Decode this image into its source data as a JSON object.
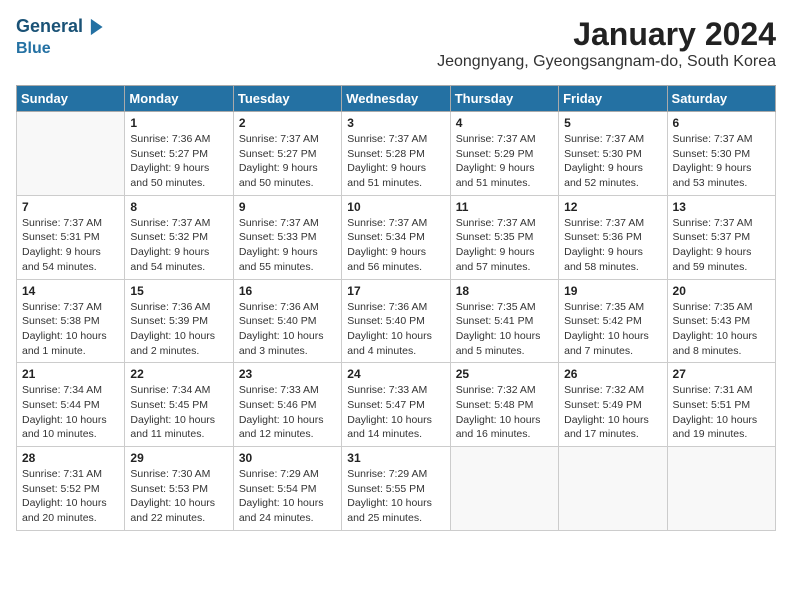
{
  "logo": {
    "line1": "General",
    "line2": "Blue",
    "arrow": "▶"
  },
  "title": "January 2024",
  "location": "Jeongnyang, Gyeongsangnam-do, South Korea",
  "weekdays": [
    "Sunday",
    "Monday",
    "Tuesday",
    "Wednesday",
    "Thursday",
    "Friday",
    "Saturday"
  ],
  "weeks": [
    [
      {
        "day": "",
        "info": ""
      },
      {
        "day": "1",
        "info": "Sunrise: 7:36 AM\nSunset: 5:27 PM\nDaylight: 9 hours\nand 50 minutes."
      },
      {
        "day": "2",
        "info": "Sunrise: 7:37 AM\nSunset: 5:27 PM\nDaylight: 9 hours\nand 50 minutes."
      },
      {
        "day": "3",
        "info": "Sunrise: 7:37 AM\nSunset: 5:28 PM\nDaylight: 9 hours\nand 51 minutes."
      },
      {
        "day": "4",
        "info": "Sunrise: 7:37 AM\nSunset: 5:29 PM\nDaylight: 9 hours\nand 51 minutes."
      },
      {
        "day": "5",
        "info": "Sunrise: 7:37 AM\nSunset: 5:30 PM\nDaylight: 9 hours\nand 52 minutes."
      },
      {
        "day": "6",
        "info": "Sunrise: 7:37 AM\nSunset: 5:30 PM\nDaylight: 9 hours\nand 53 minutes."
      }
    ],
    [
      {
        "day": "7",
        "info": "Sunrise: 7:37 AM\nSunset: 5:31 PM\nDaylight: 9 hours\nand 54 minutes."
      },
      {
        "day": "8",
        "info": "Sunrise: 7:37 AM\nSunset: 5:32 PM\nDaylight: 9 hours\nand 54 minutes."
      },
      {
        "day": "9",
        "info": "Sunrise: 7:37 AM\nSunset: 5:33 PM\nDaylight: 9 hours\nand 55 minutes."
      },
      {
        "day": "10",
        "info": "Sunrise: 7:37 AM\nSunset: 5:34 PM\nDaylight: 9 hours\nand 56 minutes."
      },
      {
        "day": "11",
        "info": "Sunrise: 7:37 AM\nSunset: 5:35 PM\nDaylight: 9 hours\nand 57 minutes."
      },
      {
        "day": "12",
        "info": "Sunrise: 7:37 AM\nSunset: 5:36 PM\nDaylight: 9 hours\nand 58 minutes."
      },
      {
        "day": "13",
        "info": "Sunrise: 7:37 AM\nSunset: 5:37 PM\nDaylight: 9 hours\nand 59 minutes."
      }
    ],
    [
      {
        "day": "14",
        "info": "Sunrise: 7:37 AM\nSunset: 5:38 PM\nDaylight: 10 hours\nand 1 minute."
      },
      {
        "day": "15",
        "info": "Sunrise: 7:36 AM\nSunset: 5:39 PM\nDaylight: 10 hours\nand 2 minutes."
      },
      {
        "day": "16",
        "info": "Sunrise: 7:36 AM\nSunset: 5:40 PM\nDaylight: 10 hours\nand 3 minutes."
      },
      {
        "day": "17",
        "info": "Sunrise: 7:36 AM\nSunset: 5:40 PM\nDaylight: 10 hours\nand 4 minutes."
      },
      {
        "day": "18",
        "info": "Sunrise: 7:35 AM\nSunset: 5:41 PM\nDaylight: 10 hours\nand 5 minutes."
      },
      {
        "day": "19",
        "info": "Sunrise: 7:35 AM\nSunset: 5:42 PM\nDaylight: 10 hours\nand 7 minutes."
      },
      {
        "day": "20",
        "info": "Sunrise: 7:35 AM\nSunset: 5:43 PM\nDaylight: 10 hours\nand 8 minutes."
      }
    ],
    [
      {
        "day": "21",
        "info": "Sunrise: 7:34 AM\nSunset: 5:44 PM\nDaylight: 10 hours\nand 10 minutes."
      },
      {
        "day": "22",
        "info": "Sunrise: 7:34 AM\nSunset: 5:45 PM\nDaylight: 10 hours\nand 11 minutes."
      },
      {
        "day": "23",
        "info": "Sunrise: 7:33 AM\nSunset: 5:46 PM\nDaylight: 10 hours\nand 12 minutes."
      },
      {
        "day": "24",
        "info": "Sunrise: 7:33 AM\nSunset: 5:47 PM\nDaylight: 10 hours\nand 14 minutes."
      },
      {
        "day": "25",
        "info": "Sunrise: 7:32 AM\nSunset: 5:48 PM\nDaylight: 10 hours\nand 16 minutes."
      },
      {
        "day": "26",
        "info": "Sunrise: 7:32 AM\nSunset: 5:49 PM\nDaylight: 10 hours\nand 17 minutes."
      },
      {
        "day": "27",
        "info": "Sunrise: 7:31 AM\nSunset: 5:51 PM\nDaylight: 10 hours\nand 19 minutes."
      }
    ],
    [
      {
        "day": "28",
        "info": "Sunrise: 7:31 AM\nSunset: 5:52 PM\nDaylight: 10 hours\nand 20 minutes."
      },
      {
        "day": "29",
        "info": "Sunrise: 7:30 AM\nSunset: 5:53 PM\nDaylight: 10 hours\nand 22 minutes."
      },
      {
        "day": "30",
        "info": "Sunrise: 7:29 AM\nSunset: 5:54 PM\nDaylight: 10 hours\nand 24 minutes."
      },
      {
        "day": "31",
        "info": "Sunrise: 7:29 AM\nSunset: 5:55 PM\nDaylight: 10 hours\nand 25 minutes."
      },
      {
        "day": "",
        "info": ""
      },
      {
        "day": "",
        "info": ""
      },
      {
        "day": "",
        "info": ""
      }
    ]
  ]
}
